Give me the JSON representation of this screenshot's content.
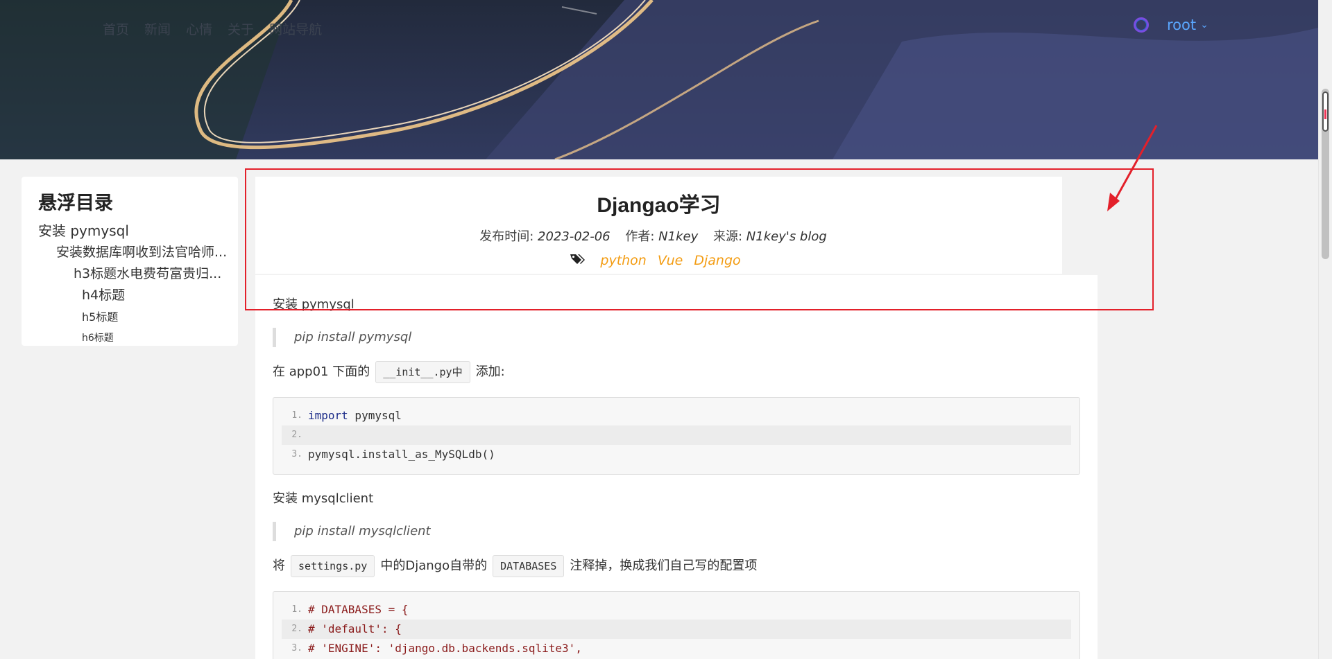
{
  "nav": {
    "items": [
      "首页",
      "新闻",
      "心情",
      "关于",
      "网站导航"
    ]
  },
  "user": {
    "name": "root"
  },
  "toc": {
    "title": "悬浮目录",
    "items": [
      {
        "level": 1,
        "label": "安装 pymysql"
      },
      {
        "level": 2,
        "label": "安装数据库啊收到法官哈师..."
      },
      {
        "level": 3,
        "label": "h3标题水电费苟富贵归..."
      },
      {
        "level": 4,
        "label": "h4标题"
      },
      {
        "level": 5,
        "label": "h5标题"
      },
      {
        "level": 6,
        "label": "h6标题"
      }
    ]
  },
  "article": {
    "title": "Djangao学习",
    "publish_label": "发布时间:",
    "publish_date": "2023-02-06",
    "author_label": "作者:",
    "author": "N1key",
    "source_label": "来源:",
    "source": "N1key's blog",
    "tags": [
      "python",
      "Vue",
      "Django"
    ],
    "p1": "安装 pymysql",
    "quote1": "pip install pymysql",
    "p2_prefix": "在 app01 下面的",
    "p2_code": "__init__.py中",
    "p2_suffix": "添加:",
    "code1": [
      "import pymysql",
      "",
      "pymysql.install_as_MySQLdb()"
    ],
    "p3": "安装 mysqlclient",
    "quote2": "pip install mysqlclient",
    "p4_prefix": "将",
    "p4_code1": "settings.py",
    "p4_mid": "中的Django自带的",
    "p4_code2": "DATABASES",
    "p4_suffix": "注释掉，换成我们自己写的配置项",
    "code2": [
      "# DATABASES = {",
      "#     'default': {",
      "#         'ENGINE': 'django.db.backends.sqlite3',"
    ]
  },
  "colors": {
    "annotation": "#e3202a",
    "tag": "#f39c12",
    "user": "#5aa7ff"
  }
}
